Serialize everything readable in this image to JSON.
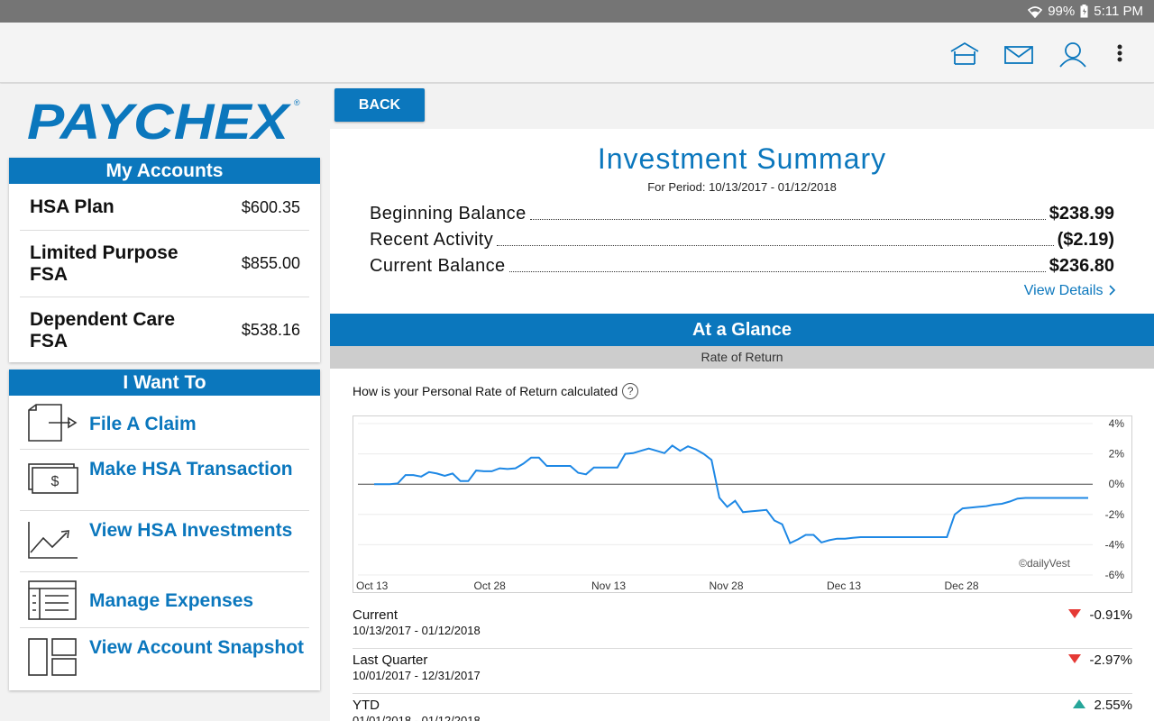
{
  "status_bar": {
    "battery": "99%",
    "time": "5:11 PM"
  },
  "app_bar": {
    "icons": [
      "home-icon",
      "mail-icon",
      "profile-icon",
      "more-icon"
    ]
  },
  "brand": {
    "logo": "PAYCHEX",
    "color": "#0b77bd"
  },
  "my_accounts": {
    "title": "My Accounts",
    "items": [
      {
        "name": "HSA Plan",
        "amount": "$600.35"
      },
      {
        "name": "Limited Purpose FSA",
        "amount": "$855.00"
      },
      {
        "name": "Dependent Care FSA",
        "amount": "$538.16"
      }
    ]
  },
  "i_want_to": {
    "title": "I Want To",
    "items": [
      {
        "label": "File A Claim",
        "icon": "file-claim-icon"
      },
      {
        "label": "Make HSA Transaction",
        "icon": "dollar-bill-icon"
      },
      {
        "label": "View HSA Investments",
        "icon": "line-chart-icon"
      },
      {
        "label": "Manage Expenses",
        "icon": "expense-list-icon"
      },
      {
        "label": "View Account Snapshot",
        "icon": "snapshot-icon"
      }
    ]
  },
  "main": {
    "back_label": "BACK",
    "title": "Investment Summary",
    "period": "For Period: 10/13/2017 - 01/12/2018",
    "balances": [
      {
        "label": "Beginning Balance",
        "value": "$238.99"
      },
      {
        "label": "Recent Activity",
        "value": "($2.19)"
      },
      {
        "label": "Current Balance",
        "value": "$236.80"
      }
    ],
    "view_details": "View Details",
    "glance_title": "At a Glance",
    "ror_title": "Rate of Return",
    "ror_question": "How is your Personal Rate of Return calculated",
    "returns": [
      {
        "name": "Current",
        "dates": "10/13/2017 - 01/12/2018",
        "value": "-0.91%",
        "direction": "down"
      },
      {
        "name": "Last Quarter",
        "dates": "10/01/2017 - 12/31/2017",
        "value": "-2.97%",
        "direction": "down"
      },
      {
        "name": "YTD",
        "dates": "01/01/2018 - 01/12/2018",
        "value": "2.55%",
        "direction": "up"
      }
    ]
  },
  "chart_data": {
    "type": "line",
    "x_tick_labels": [
      "Oct 13",
      "Oct 28",
      "Nov 13",
      "Nov 28",
      "Dec 13",
      "Dec 28"
    ],
    "y_tick_labels": [
      "4%",
      "2%",
      "0%",
      "-2%",
      "-4%",
      "-6%"
    ],
    "ylim": [
      -6,
      4
    ],
    "watermark": "©dailyVest",
    "line_color": "#1e88e5",
    "series": [
      {
        "x": [
          0,
          1,
          2,
          3,
          4,
          5,
          6,
          7,
          8,
          9,
          10,
          11,
          12,
          13,
          14,
          15,
          16,
          17,
          18,
          19,
          20,
          21,
          22,
          23,
          24,
          25,
          26,
          27,
          28,
          29,
          30,
          31,
          32,
          33,
          34,
          35,
          36,
          37,
          38,
          39,
          40,
          41,
          42,
          43,
          44,
          45,
          46,
          47,
          48,
          49,
          50,
          51,
          52,
          53,
          54,
          55,
          56,
          57,
          58,
          59,
          60,
          61,
          62,
          63,
          64,
          65,
          66,
          67,
          68,
          69,
          70,
          71,
          72,
          73,
          74,
          75,
          76,
          77,
          78,
          79,
          80,
          81,
          82,
          83,
          84,
          85,
          86,
          87,
          88,
          89,
          90,
          91
        ],
        "y": [
          0.0,
          0.0,
          0.0,
          0.05,
          0.6,
          0.6,
          0.5,
          0.8,
          0.7,
          0.55,
          0.7,
          0.2,
          0.2,
          0.9,
          0.85,
          0.85,
          1.05,
          1.0,
          1.05,
          1.35,
          1.75,
          1.75,
          1.2,
          1.2,
          1.2,
          1.2,
          0.75,
          0.65,
          1.1,
          1.1,
          1.1,
          1.1,
          2.0,
          2.05,
          2.2,
          2.35,
          2.2,
          2.05,
          2.55,
          2.2,
          2.5,
          2.3,
          2.0,
          1.6,
          -0.9,
          -1.5,
          -1.1,
          -1.85,
          -1.8,
          -1.75,
          -1.7,
          -2.4,
          -2.65,
          -3.9,
          -3.65,
          -3.35,
          -3.35,
          -3.85,
          -3.7,
          -3.6,
          -3.6,
          -3.55,
          -3.5,
          -3.5,
          -3.5,
          -3.5,
          -3.5,
          -3.5,
          -3.5,
          -3.5,
          -3.5,
          -3.5,
          -3.5,
          -3.5,
          -2.0,
          -1.6,
          -1.55,
          -1.5,
          -1.45,
          -1.35,
          -1.3,
          -1.15,
          -0.95,
          -0.91,
          -0.91,
          -0.91,
          -0.91,
          -0.91,
          -0.91,
          -0.91,
          -0.91,
          -0.91
        ]
      }
    ]
  }
}
